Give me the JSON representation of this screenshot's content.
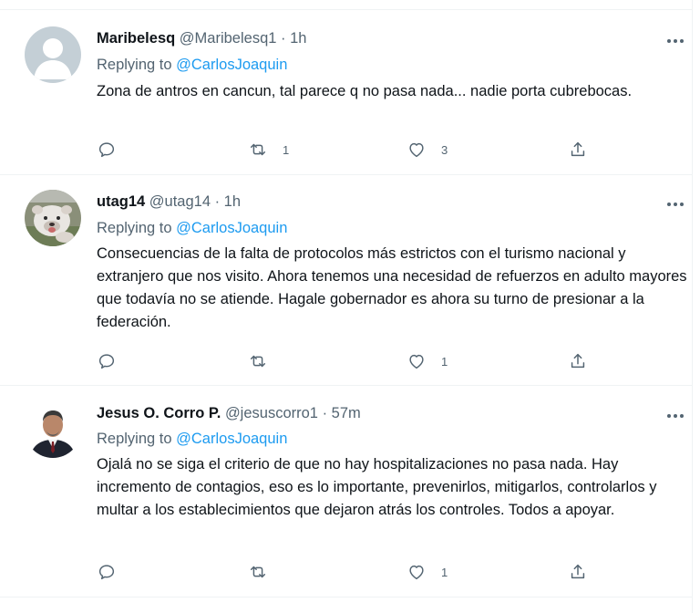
{
  "tweets": [
    {
      "name": "Maribelesq",
      "handle": "@Maribelesq1",
      "time": "· 1h",
      "replying_prefix": "Replying to ",
      "replying_to": "@CarlosJoaquin",
      "text": "Zona de antros en cancun, tal parece q no pasa nada... nadie porta cubrebocas.",
      "reply_count": "",
      "retweet_count": "1",
      "like_count": "3",
      "avatar": "default-avatar-icon"
    },
    {
      "name": "utag14",
      "handle": "@utag14",
      "time": "· 1h",
      "replying_prefix": "Replying to ",
      "replying_to": "@CarlosJoaquin",
      "text": "Consecuencias de la falta de protocolos más estrictos con el turismo nacional y extranjero que nos visito. Ahora tenemos una necesidad de refuerzos en adulto mayores que todavía no se atiende. Hagale gobernador es ahora su turno de presionar a la federación.",
      "reply_count": "",
      "retweet_count": "",
      "like_count": "1",
      "avatar": "bulldog-photo"
    },
    {
      "name": "Jesus O. Corro P.",
      "handle": "@jesuscorro1",
      "time": "· 57m",
      "replying_prefix": "Replying to ",
      "replying_to": "@CarlosJoaquin",
      "text": "Ojalá no se siga el criterio de que no hay hospitalizaciones no pasa nada. Hay incremento de contagios, eso es lo importante, prevenirlos, mitigarlos, controlarlos y multar a los establecimientos que dejaron atrás los controles. Todos a apoyar.",
      "reply_count": "",
      "retweet_count": "",
      "like_count": "1",
      "avatar": "man-in-suit-photo"
    }
  ],
  "colors": {
    "text": "#0f1419",
    "secondary": "#536471",
    "link": "#1d9bf0",
    "divider": "#eff3f4"
  }
}
